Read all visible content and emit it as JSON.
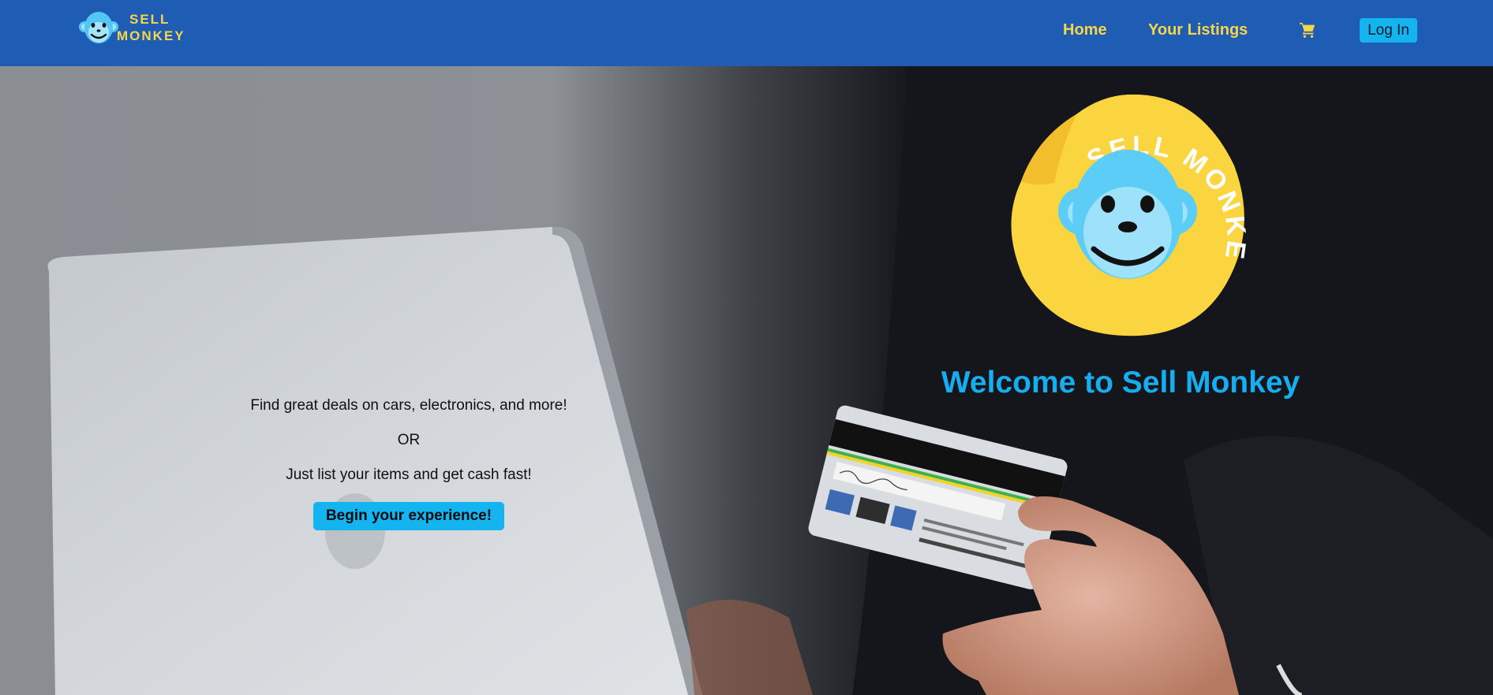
{
  "navbar": {
    "brand": {
      "line1": "SELL",
      "line2": "MONKEY",
      "icon": "monkey-logo-icon"
    },
    "links": {
      "home": "Home",
      "listings": "Your Listings"
    },
    "cart_icon": "shopping-cart-icon",
    "login_label": "Log In",
    "colors": {
      "background": "#1f5cb3",
      "link": "#f7d54a",
      "button": "#14b4f0"
    }
  },
  "hero": {
    "tagline_1": "Find great deals on cars, electronics, and more!",
    "or_text": "OR",
    "tagline_2": "Just list your items and get cash fast!",
    "cta_label": "Begin your experience!",
    "sticker_text": "SELL MONKEY",
    "welcome": "Welcome to Sell Monkey",
    "colors": {
      "welcome": "#16aef0",
      "sticker": "#fbd540",
      "monkey": "#5ccdf7"
    }
  }
}
